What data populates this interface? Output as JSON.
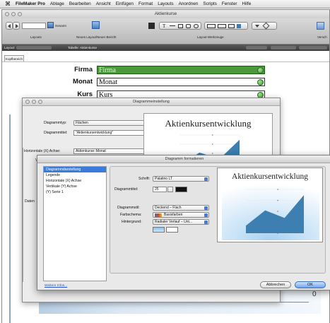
{
  "menubar": {
    "app": "FileMaker Pro",
    "items": [
      "Ablage",
      "Bearbeiten",
      "Ansicht",
      "Einfügen",
      "Format",
      "Layouts",
      "Anordnen",
      "Scripts",
      "Fenster",
      "Hilfe"
    ]
  },
  "window": {
    "title": "Aktienkurse",
    "toolbar": {
      "layout_label": "Layouts",
      "layout_count": "Gesamt",
      "new_layout_label": "Neues Layout/Neuer Bericht",
      "tools_label": "Layout-Werkzeuge",
      "right_label": "Versch"
    },
    "statusbar": {
      "left": "Layout:",
      "table_label": "Tabelle:",
      "table": "Aktienkurse"
    },
    "layout_tab": "Kopfbereich"
  },
  "fields": [
    {
      "label": "Firma",
      "value": "Firma"
    },
    {
      "label": "Monat",
      "value": "Monat"
    },
    {
      "label": "Kurs",
      "value": "Kurs"
    }
  ],
  "chart_setup": {
    "title": "Diagrammeinstellung",
    "type_label": "Diagrammtyp:",
    "type_value": "Flächen",
    "title_label": "Diagrammtitel:",
    "title_value": "\"Aktienkursentwicklung\"",
    "x_axis_label": "Horizontale (X) Achse:",
    "x_axis_value": "Aktienkurse::Monat",
    "y_axis_short": "Ve",
    "preview_title": "Aktienkursentwicklung",
    "data_label": "Daten",
    "axis_zero": "0"
  },
  "format_dialog": {
    "title": "Diagramm formatieren",
    "list": [
      "Diagrammdarstellung",
      "Legende",
      "Horizontale (X) Achse",
      "Vertikale (Y) Achse",
      "(Y) Serie 1"
    ],
    "selected_index": 0,
    "font_label": "Schrift:",
    "font_value": "Palatino LT",
    "title_size_label": "Diagrammtitel:",
    "title_size_value": "25",
    "style_label": "Diagrammstil:",
    "style_value": "Deckend – Flach",
    "color_scheme_label": "Farbschema:",
    "color_scheme_value": "Basisfarben",
    "background_label": "Hintergrund:",
    "background_value": "Radialer Verlauf – Unt...",
    "preview_title": "Aktienkursentwicklung",
    "more_info": "Weitere Infos...",
    "cancel": "Abbrechen",
    "ok": "OK"
  },
  "colors": {
    "accent_blue": "#3b7bdc",
    "chart_fill": "#3d7fb0",
    "field_green": "#4a9a3a"
  },
  "chart_data": {
    "type": "area",
    "title": "Aktienkursentwicklung",
    "series": [
      {
        "values": [
          1,
          3,
          2,
          5
        ]
      }
    ]
  }
}
